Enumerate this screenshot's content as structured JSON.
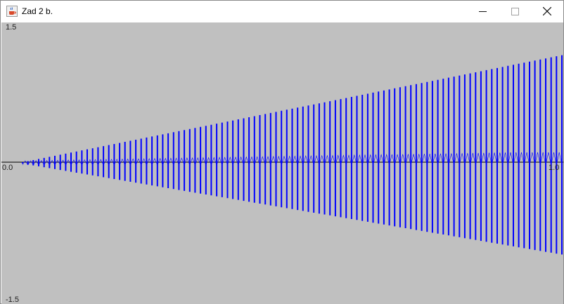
{
  "window": {
    "title": "Zad 2 b.",
    "icon": "java-cup-icon",
    "controls": {
      "minimize": "minimize-icon",
      "maximize": "maximize-icon",
      "close": "close-icon"
    }
  },
  "plot": {
    "y_max_label": "1.5",
    "y_zero_label": "0.0",
    "y_min_label": "-1.5",
    "x_max_label": "1.0",
    "background": "#c0c0c0",
    "axis_color": "#000000",
    "series_color": "#0000ff"
  },
  "chart_data": {
    "type": "line",
    "xlim": [
      0.0,
      1.0
    ],
    "ylim": [
      -1.5,
      1.5
    ],
    "ylabel": "",
    "xlabel": "",
    "title": "",
    "series": [
      {
        "samples": 101,
        "amplitude_start": 0.0,
        "amplitude_end": 1.2,
        "envelope": "linear growth"
      }
    ]
  }
}
